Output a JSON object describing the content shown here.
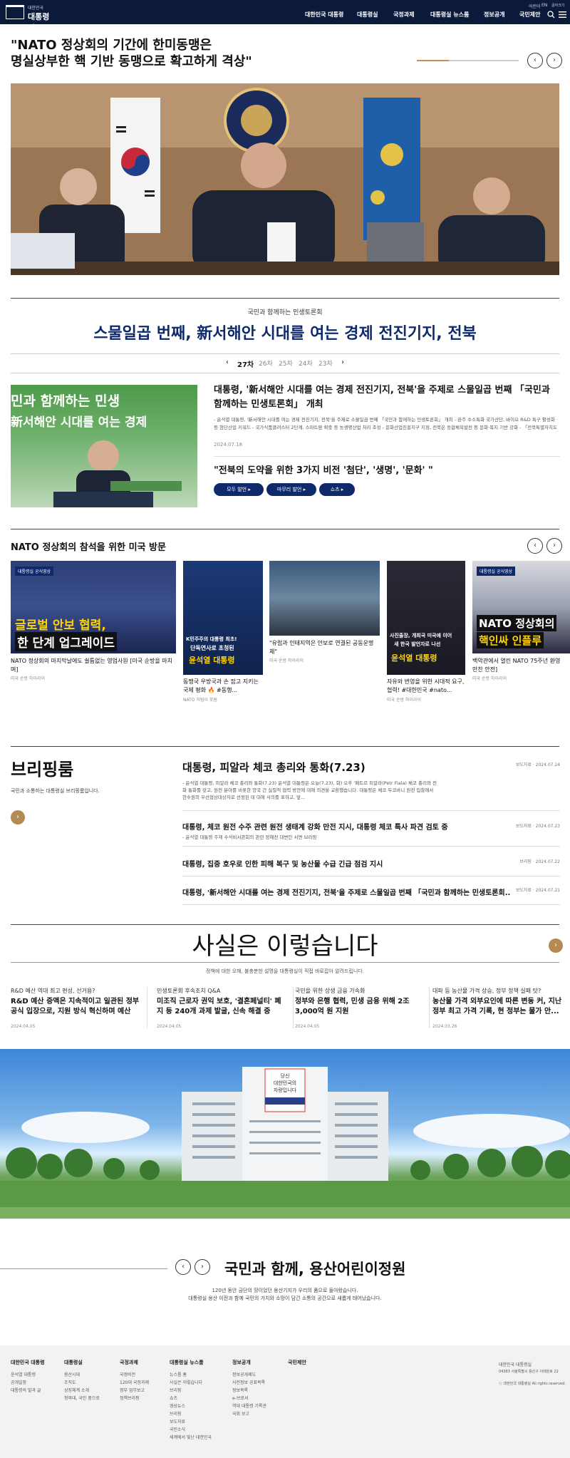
{
  "header": {
    "logo_small": "대한민국",
    "logo_big": "대통령실",
    "nav": [
      "대한민국 대통령",
      "대통령실",
      "국정과제",
      "대통령실 뉴스룸",
      "정보공개",
      "국민제안"
    ],
    "utils": [
      "어린이",
      "EN",
      "글자크기"
    ]
  },
  "hero": {
    "title_line1": "\"NATO 정상회의 기간에 한미동맹은",
    "title_line2": "명실상부한 핵 기반 동맹으로 확고하게 격상\"",
    "prev": "‹",
    "next": "›"
  },
  "forum": {
    "subtitle": "국민과 함께하는 민생토론회",
    "title": "스물일곱 번째, 新서해안 시대를 여는 경제 전진기지, 전북",
    "rounds": [
      "27차",
      "26차",
      "25차",
      "24차",
      "23차"
    ],
    "image_text1": "민과 함께하는 민생",
    "image_text2": "新서해안 시대를 여는 경제",
    "headline": "대통령, '新서해안 시대를 여는 경제 전진기지, 전북'을 주제로 스물일곱 번째 「국민과 함께하는 민생토론회」 개최",
    "desc": "- 윤석열 대통령, '新서해안 시대를 여는 경제 전진기지, 전북'을 주제로 스물일곱 번째 「국민과 함께하는 민생토론회」 개최 - 완주 수소특화 국가산단, 바이오 R&D 특구 활성화 등 첨단산업 키워드 - 국가식품클러스터 2단계, 스마트팜 확충 등 농생명산업 처리 조성 - 문화산업진흥지구 지정, 전북은 동합체육발전 등 문화·복지 기반 강화 - 「전북특별자치도법」...",
    "date": "2024.07.18",
    "quote": "\"전북의 도약을 위한 3가지 비전 '첨단', '생명', '문화' \"",
    "pills": [
      "모두 발언",
      "마무리 발언",
      "쇼츠"
    ]
  },
  "nato": {
    "title": "NATO 정상회의 참석을 위한 미국 방문",
    "cards": [
      {
        "tag": "대통령실 공식영상",
        "overlay1": "글로벌 안보 협력,",
        "overlay2": "한 단계 업그레이드",
        "caption": "NATO 정상회의 마지막날에도 쉴틈없는 영업사원 [미국 순방을 마치며]",
        "source": "미국 순방 하이라이"
      },
      {
        "overlay1": "K민주주의 대통령 최초!",
        "overlay2": "단독연사로 초청된",
        "overlay3": "윤석열 대통령",
        "caption": "동맹국 우방국과 손 잡고 지키는 국제 평화 🔥 #동행...",
        "source": "NATO 허팀이 포럼"
      },
      {
        "caption": "\"유럽과 인태지역은 안보로 연결된 공동운명체\"",
        "source": "미국 순방 하이라이"
      },
      {
        "overlay1": "사진출장, 개최국 미국에 이어",
        "overlay2": "새 한국 발언자로 나선",
        "overlay3": "윤석열 대통령",
        "caption": "자유와 번영을 위한 시대적 요구, 협력! #대한민국 #nato...",
        "source": "미국 순방 하이라이"
      },
      {
        "tag": "대통령실 공식영상",
        "overlay1": "NATO 정상회의",
        "overlay2": "핵인싸 인플루",
        "caption": "백악관에서 열린 NATO 75주년 환영만찬 안전]",
        "source": "미국 순방 하이라이"
      }
    ]
  },
  "briefing": {
    "title": "브리핑룸",
    "subtitle": "국민과 소통하는 대통령실 브리핑룸입니다.",
    "arrow": "›",
    "items": [
      {
        "title": "대통령, 피알라 체코 총리와 통화(7.23)",
        "meta": "보도자료 · 2024.07.24",
        "desc": "- 윤석열 대통령, 피알라 체코 총리와 통화(7.23) 윤석열 대통령은 오늘(7.23), 화) 오후 '페트르 피알라(Petr Fiala) 체코 총리와 전화 통화를 갖고, 원전 분야를 비롯한 양국 간 실질적 협력 방안에 대해 의견을 교환했습니다. 대통령은 체코 두코바니 원전 입찰에서 한수원의 우선협상대상자로 선정된 데 대해 사의를 표하고, 앞..."
      },
      {
        "title": "대통령, 체코 원전 수주 관련 원전 생태계 강화 만전 지시, 대통령 체코 특사 파견 검토 중",
        "meta": "보도자료 · 2024.07.23",
        "desc": "- 윤석열 대통령 주재 수석비서관회의 관련 정혜전 대변인 서면 브리핑"
      },
      {
        "title": "대통령, 집중 호우로 인한 피해 복구 및 농산물 수급 긴급 점검 지시",
        "meta": "브리핑 · 2024.07.22",
        "desc": ""
      },
      {
        "title": "대통령, '新서해안 시대를 여는 경제 전진기지, 전북'을 주제로 스물일곱 번째 「국민과 함께하는 민생토론회...",
        "meta": "보도자료 · 2024.07.21",
        "desc": ""
      }
    ]
  },
  "facts": {
    "title": "사실은 이렇습니다",
    "subtitle": "정책에 대한 오해, 불충분한 설명을 대통령실이 직접 바로잡아 알려드립니다.",
    "arrow": "›",
    "items": [
      {
        "category": "R&D 예산 역대 최고 편성, 선거용?",
        "title": "R&D 예산 증액은 지속적이고 일관된 정부 공식 입장으로, 지원 방식 혁신하며 예산 ...",
        "date": "2024.04.05"
      },
      {
        "category": "민생토론회 후속조치 Q&A",
        "title": "미조직 근로자 권익 보호, '결혼페널티' 폐지 등 240개 과제 발굴, 신속 해결 중",
        "date": "2024.04.05"
      },
      {
        "category": "국민을 위한 상생 금융 가속화",
        "title": "정부와 은행 협력, 민생 금융 위해 2조 3,000억 원 지원",
        "date": "2024.04.05"
      },
      {
        "category": "대파 등 농산물 가격 상승, 정부 정책 실패 탓?",
        "title": "농산물 가격 외부요인에 따른 변동 커, 지난 정부 최고 가격 기록, 현 정부는 물가 안...",
        "date": "2024.03.26"
      }
    ]
  },
  "building": {
    "banner1": "당신",
    "banner2": "대한민국의",
    "banner3": "자랑입니다"
  },
  "kids": {
    "title": "국민과 함께, 용산어린이정원",
    "desc1": "120년 동안 금단의 땅이었던 용산기지가 우리의 품으로 돌아왔습니다.",
    "desc2": "대통령실 용산 이전과 함께 국민의 가치와 소망이 담긴 소통의 공간으로 새롭게 태어났습니다.",
    "prev": "‹",
    "next": "›"
  },
  "footer": {
    "columns": [
      {
        "head": "대한민국 대통령",
        "links": [
          "윤석열 대통령",
          "공개일정",
          "대통령의 말과 글"
        ]
      },
      {
        "head": "대통령실",
        "links": [
          "용산시대",
          "조직도",
          "상징체계 소개",
          "청와대, 국민 품으로"
        ]
      },
      {
        "head": "국정과제",
        "links": [
          "국정비전",
          "120대 국정과제",
          "정부 업무보고",
          "정책브리핑"
        ]
      },
      {
        "head": "대통령실 뉴스룸",
        "links": [
          "뉴스룸 홈",
          "사실은 이렇습니다",
          "브리핑",
          "쇼츠",
          "영상뉴스",
          "브리핑",
          "보도자료",
          "국민소식",
          "세계에서 빛난 대한민국"
        ]
      },
      {
        "head": "정보공개",
        "links": [
          "정보공개제도",
          "사전정보 공표목록",
          "정보목록",
          "e-브로셔",
          "역대 대통령 기록관",
          "국회 보고"
        ]
      },
      {
        "head": "국민제안",
        "links": []
      }
    ],
    "info1": "대한민국 대통령실",
    "info2": "04383 서울특별시 용산구 이태원로 22",
    "info3": "ⓒ 대한민국 대통령실 All rights reserved."
  }
}
